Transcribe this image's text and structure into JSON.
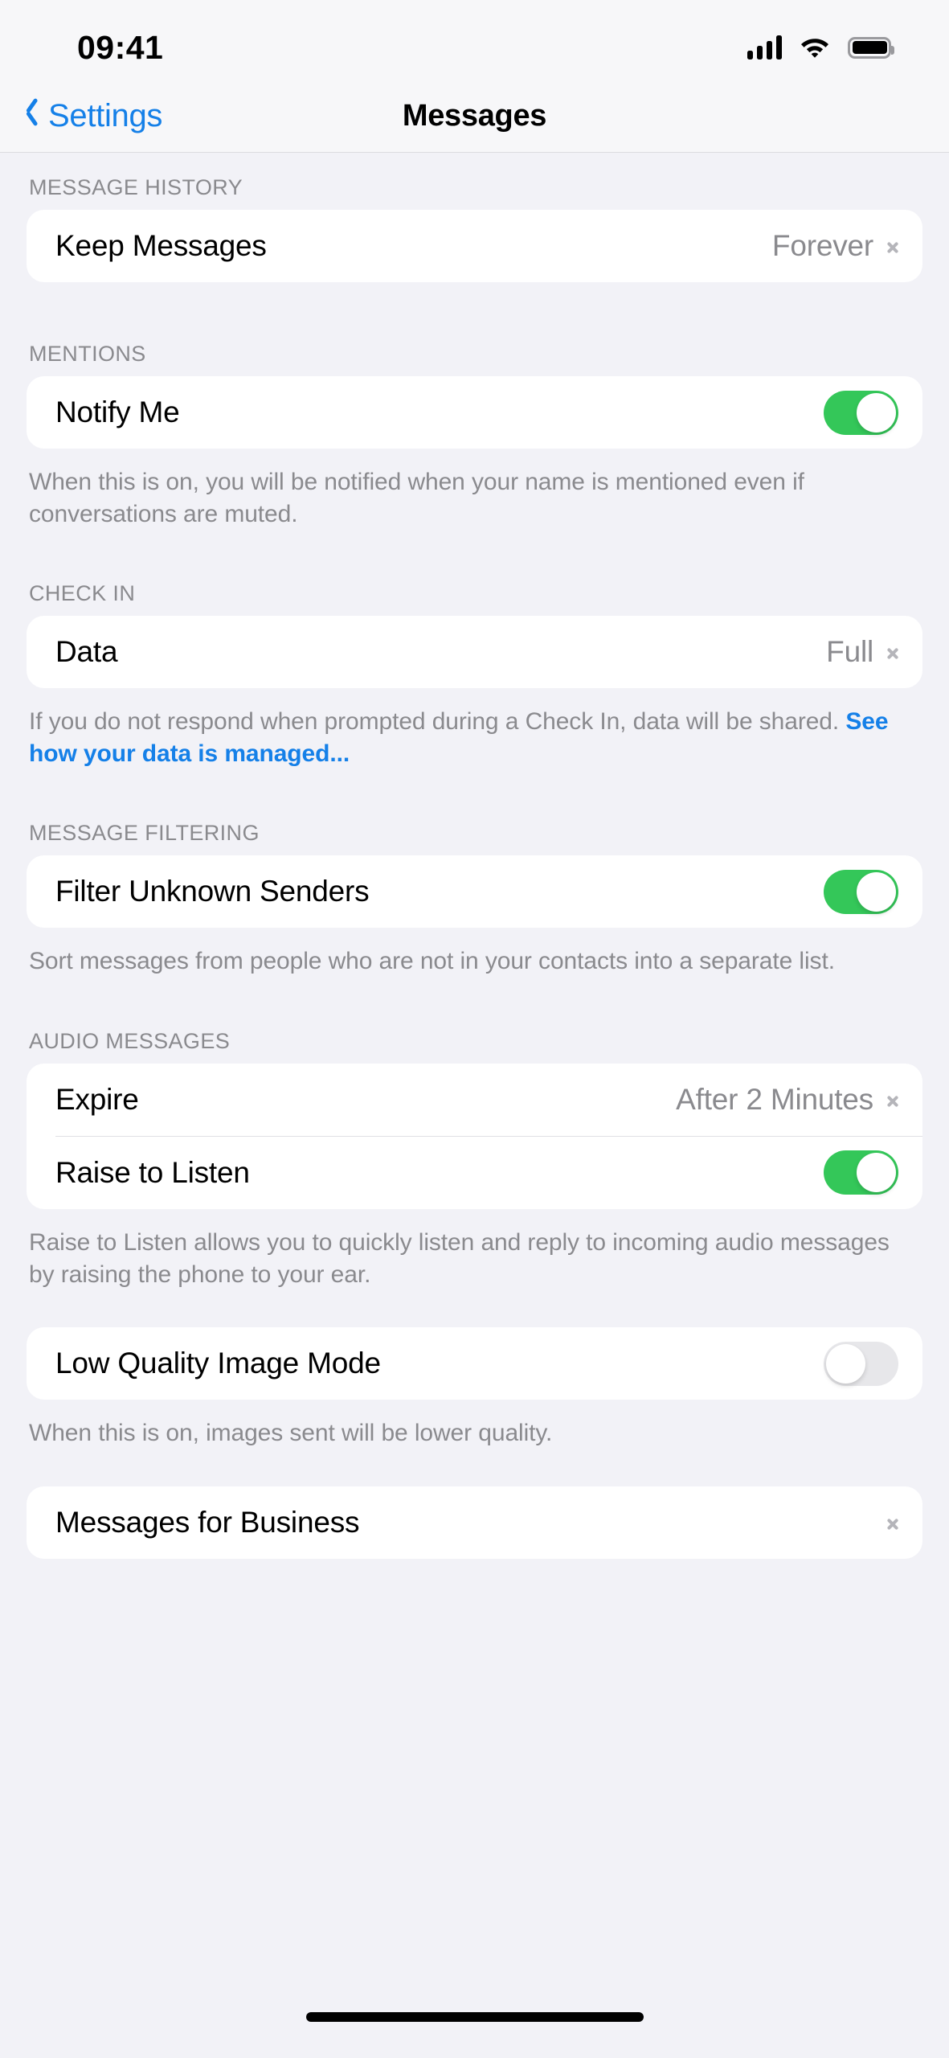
{
  "status_bar": {
    "time": "09:41",
    "signal_icon": "cellular-signal-icon",
    "wifi_icon": "wifi-icon",
    "battery_icon": "battery-full-icon"
  },
  "nav": {
    "back_label": "Settings",
    "title": "Messages",
    "back_icon": "chevron-left-icon"
  },
  "sections": {
    "message_history": {
      "header": "MESSAGE HISTORY",
      "keep_messages": {
        "label": "Keep Messages",
        "value": "Forever"
      }
    },
    "mentions": {
      "header": "MENTIONS",
      "notify_me": {
        "label": "Notify Me",
        "state": "on"
      },
      "footer": "When this is on, you will be notified when your name is mentioned even if conversations are muted."
    },
    "check_in": {
      "header": "CHECK IN",
      "data": {
        "label": "Data",
        "value": "Full"
      },
      "footer_text": "If you do not respond when prompted during a Check In, data will be shared. ",
      "footer_link": "See how your data is managed..."
    },
    "message_filtering": {
      "header": "MESSAGE FILTERING",
      "filter_unknown_senders": {
        "label": "Filter Unknown Senders",
        "state": "on"
      },
      "footer": "Sort messages from people who are not in your contacts into a separate list."
    },
    "audio_messages": {
      "header": "AUDIO MESSAGES",
      "expire": {
        "label": "Expire",
        "value": "After 2 Minutes"
      },
      "raise_to_listen": {
        "label": "Raise to Listen",
        "state": "on"
      },
      "footer": "Raise to Listen allows you to quickly listen and reply to incoming audio messages by raising the phone to your ear."
    },
    "image_quality": {
      "low_quality_image_mode": {
        "label": "Low Quality Image Mode",
        "state": "off"
      },
      "footer": "When this is on, images sent will be lower quality."
    },
    "business": {
      "messages_for_business": {
        "label": "Messages for Business"
      }
    }
  },
  "colors": {
    "accent_blue": "#1580E8",
    "toggle_on_green": "#34C759",
    "toggle_off_gray": "#E7E7EA",
    "page_background": "#F2F2F7",
    "group_background": "#FFFFFF",
    "secondary_text": "#8A8A8E"
  }
}
